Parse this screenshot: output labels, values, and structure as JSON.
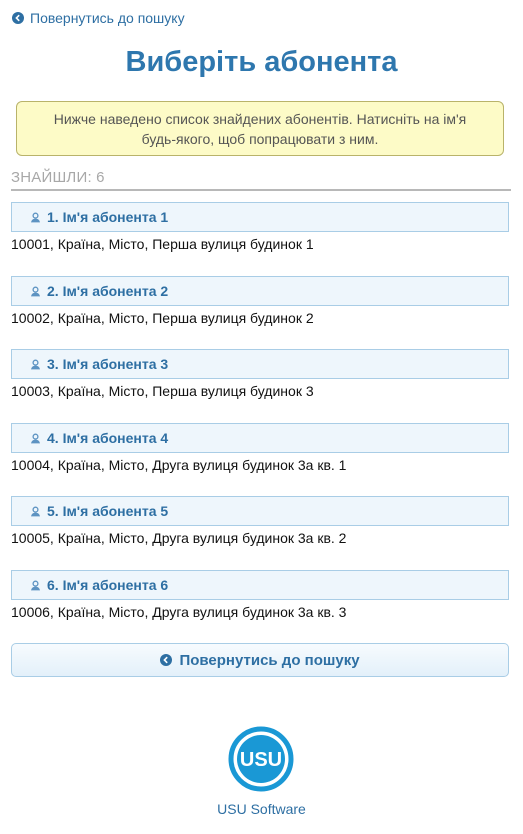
{
  "top_back_label": "Повернутись до пошуку",
  "page_title": "Виберіть абонента",
  "notice": {
    "line1": "Нижче наведено список знайдених абонентів. Натисніть на ім'я",
    "line2": "будь-якого, щоб попрацювати з ним."
  },
  "found_label": "ЗНАЙШЛИ: 6",
  "subscribers": [
    {
      "name": "1. Ім'я абонента 1",
      "address": "10001, Країна, Місто, Перша вулиця будинок 1"
    },
    {
      "name": "2. Ім'я абонента 2",
      "address": "10002, Країна, Місто, Перша вулиця будинок 2"
    },
    {
      "name": "3. Ім'я абонента 3",
      "address": "10003, Країна, Місто, Перша вулиця будинок 3"
    },
    {
      "name": "4. Ім'я абонента 4",
      "address": "10004, Країна, Місто, Друга вулиця будинок 3а кв. 1"
    },
    {
      "name": "5. Ім'я абонента 5",
      "address": "10005, Країна, Місто, Друга вулиця будинок 3а кв. 2"
    },
    {
      "name": "6. Ім'я абонента 6",
      "address": "10006, Країна, Місто, Друга вулиця будинок 3а кв. 3"
    }
  ],
  "bottom_back_label": "Повернутись до пошуку",
  "logo_text": "USU",
  "logo_caption": "USU Software",
  "colors": {
    "accent": "#2e6fa3",
    "title": "#2e77ae",
    "notice_bg": "#fdfbc7",
    "item_bg": "#eef6fc",
    "logo": "#1a98d5"
  }
}
